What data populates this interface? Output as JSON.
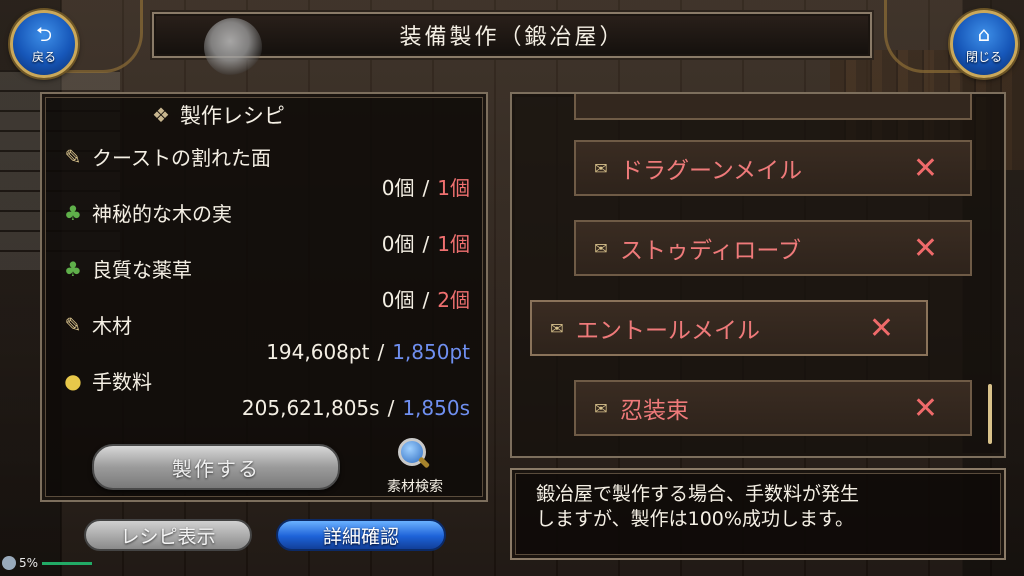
{
  "header": {
    "title": "装備製作（鍛冶屋）",
    "back_label": "戻る",
    "close_label": "閉じる",
    "back_icon": "return-arrow-icon",
    "close_icon": "home-icon"
  },
  "recipe": {
    "title": "製作レシピ",
    "materials": [
      {
        "icon": "scroll-icon",
        "name": "クーストの割れた面",
        "have": "0個",
        "need": "1個",
        "need_color": "#f07070"
      },
      {
        "icon": "herb-icon",
        "name": "神秘的な木の実",
        "have": "0個",
        "need": "1個",
        "need_color": "#f07070"
      },
      {
        "icon": "herb-icon",
        "name": "良質な薬草",
        "have": "0個",
        "need": "2個",
        "need_color": "#f07070"
      },
      {
        "icon": "scroll-icon",
        "name": "木材",
        "have": "194,608pt",
        "need": "1,850pt",
        "need_color": "#6f8ff0"
      },
      {
        "icon": "coin-icon",
        "name": "手数料",
        "have": "205,621,805s",
        "need": "1,850s",
        "need_color": "#6f8ff0"
      }
    ],
    "separator": "/",
    "craft_button": "製作する",
    "search_label": "素材検索"
  },
  "tabs": {
    "recipe_view": "レシピ表示",
    "detail_check": "詳細確認"
  },
  "status": {
    "battery": "5%"
  },
  "equipment_list": [
    {
      "name": "ドラグーンメイル",
      "mark": "✕"
    },
    {
      "name": "ストゥディローブ",
      "mark": "✕"
    },
    {
      "name": "エントールメイル",
      "mark": "✕"
    },
    {
      "name": "忍装束",
      "mark": "✕"
    }
  ],
  "message": {
    "line1": "鍛冶屋で製作する場合、手数料が発生",
    "line2": "しますが、製作は100%成功します。"
  }
}
